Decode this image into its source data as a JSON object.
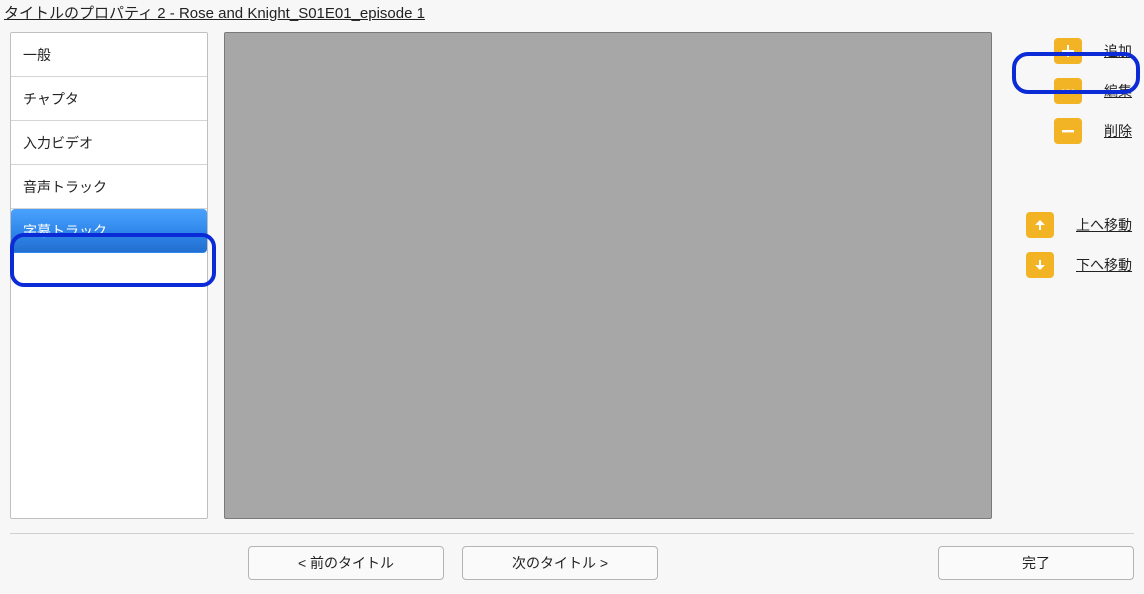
{
  "window_title": "タイトルのプロパティ 2 - Rose and Knight_S01E01_episode 1",
  "sidebar": {
    "items": [
      {
        "label": "一般"
      },
      {
        "label": "チャプタ"
      },
      {
        "label": "入力ビデオ"
      },
      {
        "label": "音声トラック"
      },
      {
        "label": "字幕トラック"
      }
    ],
    "selected_index": 4
  },
  "actions": {
    "add": "追加",
    "edit": "編集",
    "delete": "削除",
    "move_up": "上へ移動",
    "move_down": "下へ移動"
  },
  "footer": {
    "prev": "< 前のタイトル",
    "next": "次のタイトル >",
    "done": "完了"
  }
}
